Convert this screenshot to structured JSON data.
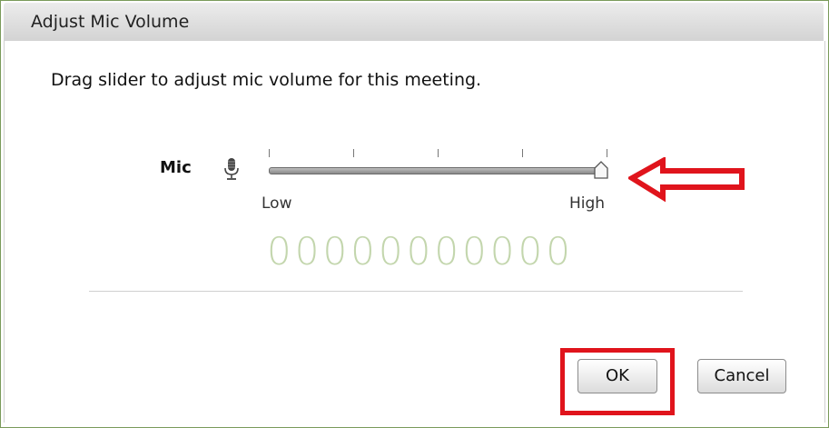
{
  "dialog": {
    "title": "Adjust Mic Volume",
    "instruction": "Drag slider to adjust mic volume for this meeting."
  },
  "mic": {
    "label": "Mic",
    "icon": "microphone-icon",
    "slider_level_fraction": 1.0,
    "low_label": "Low",
    "high_label": "High",
    "meter_readout": "00000000000"
  },
  "buttons": {
    "ok_label": "OK",
    "cancel_label": "Cancel"
  },
  "annotations": {
    "arrow_color": "#e0141c",
    "highlight_color": "#e0141c"
  },
  "colors": {
    "meter": "#c3d6ad",
    "titlebar": "#d9d9d9"
  }
}
